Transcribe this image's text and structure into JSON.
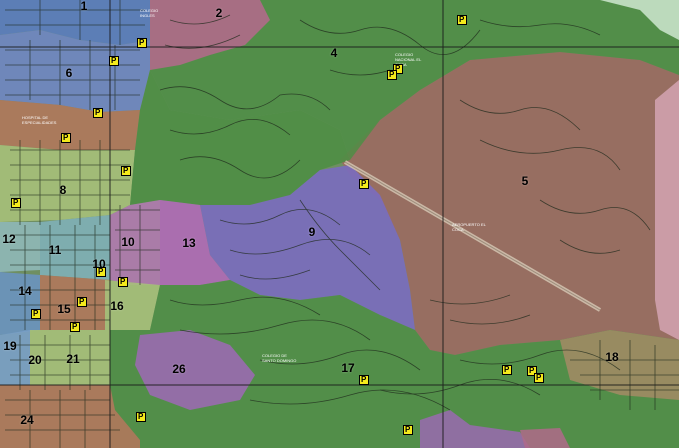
{
  "map": {
    "zones": [
      {
        "id": "1",
        "label": "1",
        "color": "#5a7cc0"
      },
      {
        "id": "2",
        "label": "2",
        "color": "#b06a8a"
      },
      {
        "id": "4",
        "label": "4",
        "color": "#4e8e45"
      },
      {
        "id": "5",
        "label": "5",
        "color": "#9b6a62"
      },
      {
        "id": "6",
        "label": "6",
        "color": "#6f86c4"
      },
      {
        "id": "8",
        "label": "8",
        "color": "#a6c07a"
      },
      {
        "id": "9",
        "label": "9",
        "color": "#7a6cc0"
      },
      {
        "id": "10",
        "label": "10",
        "color": "#b07ab0"
      },
      {
        "id": "11",
        "label": "11",
        "color": "#7fb0b8"
      },
      {
        "id": "12",
        "label": "12",
        "color": "#8fb8b8"
      },
      {
        "id": "13",
        "label": "13",
        "color": "#b06ab8"
      },
      {
        "id": "14",
        "label": "14",
        "color": "#6a94c0"
      },
      {
        "id": "15",
        "label": "15",
        "color": "#b0785c"
      },
      {
        "id": "16",
        "label": "16",
        "color": "#a6c07a"
      },
      {
        "id": "17",
        "label": "17",
        "color": "#4e8e45"
      },
      {
        "id": "18",
        "label": "18",
        "color": "#b08a6a"
      },
      {
        "id": "19",
        "label": "19",
        "color": "#7aa0c8"
      },
      {
        "id": "20",
        "label": "20",
        "color": "#a6c07a"
      },
      {
        "id": "21",
        "label": "21",
        "color": "#a6c07a"
      },
      {
        "id": "24",
        "label": "24",
        "color": "#b0785c"
      },
      {
        "id": "26",
        "label": "26",
        "color": "#9a6ab0"
      }
    ],
    "marker_symbol": "P",
    "marker_color": "#f4ea1c",
    "place_labels": [
      {
        "text": "COLEGIO INGLES"
      },
      {
        "text": "HOSPITAL DE ESPECIALIDADES"
      },
      {
        "text": "COLEGIO NACIONAL EL COCA"
      },
      {
        "text": "AEROPUERTO EL COCA"
      },
      {
        "text": "COLEGIO DE SANTO DOMINGO"
      }
    ]
  }
}
